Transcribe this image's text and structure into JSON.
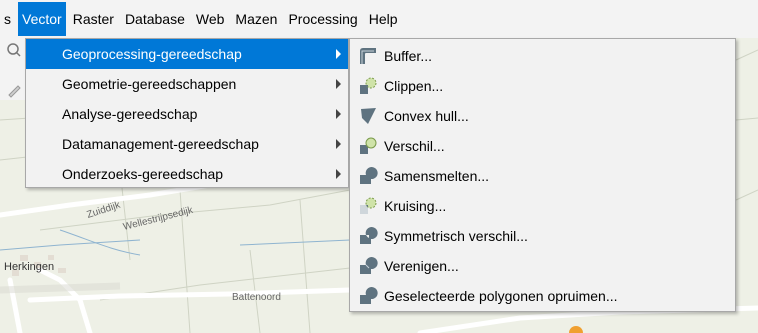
{
  "menubar": {
    "items": [
      {
        "label": "s",
        "name": "menu-settings-partial"
      },
      {
        "label": "Vector",
        "name": "menu-vector"
      },
      {
        "label": "Raster",
        "name": "menu-raster"
      },
      {
        "label": "Database",
        "name": "menu-database"
      },
      {
        "label": "Web",
        "name": "menu-web"
      },
      {
        "label": "Mazen",
        "name": "menu-mazen"
      },
      {
        "label": "Processing",
        "name": "menu-processing"
      },
      {
        "label": "Help",
        "name": "menu-help"
      }
    ]
  },
  "vector_menu": {
    "items": [
      {
        "label": "Geoprocessing-gereedschap",
        "name": "geoprocessing-tools"
      },
      {
        "label": "Geometrie-gereedschappen",
        "name": "geometry-tools"
      },
      {
        "label": "Analyse-gereedschap",
        "name": "analysis-tools"
      },
      {
        "label": "Datamanagement-gereedschap",
        "name": "data-management-tools"
      },
      {
        "label": "Onderzoeks-gereedschap",
        "name": "research-tools"
      }
    ]
  },
  "geoprocessing_submenu": {
    "items": [
      {
        "label": "Buffer...",
        "icon": "buffer-icon"
      },
      {
        "label": "Clippen...",
        "icon": "clip-icon"
      },
      {
        "label": "Convex hull...",
        "icon": "convex-hull-icon"
      },
      {
        "label": "Verschil...",
        "icon": "difference-icon"
      },
      {
        "label": "Samensmelten...",
        "icon": "dissolve-icon"
      },
      {
        "label": "Kruising...",
        "icon": "intersection-icon"
      },
      {
        "label": "Symmetrisch verschil...",
        "icon": "symmetrical-difference-icon"
      },
      {
        "label": "Verenigen...",
        "icon": "union-icon"
      },
      {
        "label": "Geselecteerde polygonen opruimen...",
        "icon": "eliminate-polygons-icon"
      }
    ]
  },
  "map": {
    "labels": {
      "street1": "Zuiddijk",
      "street2": "Wellestrijpsedijk",
      "town": "Herkingen",
      "street3": "Battenoord"
    }
  },
  "colors": {
    "accent": "#0078d7",
    "menu_bg": "#f2f2f2",
    "icon_grey": "#5f7380",
    "map_bg": "#eef0e6",
    "road": "#ffffff",
    "water_line": "#8fb4d0"
  }
}
